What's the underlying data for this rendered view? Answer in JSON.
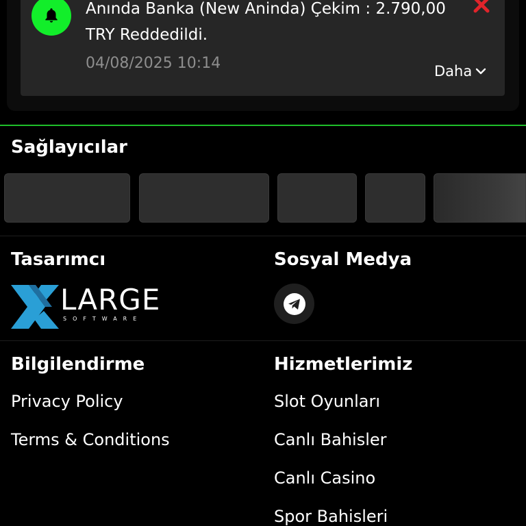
{
  "notification": {
    "message": "Anında Banka (New Aninda) Çekim : 2.790,00 TRY Reddedildi.",
    "timestamp": "04/08/2025 10:14",
    "more_label": "Daha",
    "icon": "bell-icon",
    "close_icon": "close-icon",
    "bell_color": "#12ee2a",
    "close_color": "#e0242b"
  },
  "providers": {
    "title": "Sağlayıcılar"
  },
  "designer": {
    "title": "Tasarımcı",
    "logo_main": "LARGE",
    "logo_sub": "SOFTWARE"
  },
  "social": {
    "title": "Sosyal Medya",
    "icon": "telegram-icon"
  },
  "info": {
    "title": "Bilgilendirme",
    "links": [
      "Privacy Policy",
      "Terms & Conditions"
    ]
  },
  "services": {
    "title": "Hizmetlerimiz",
    "links": [
      "Slot Oyunları",
      "Canlı Bahisler",
      "Canlı Casino",
      "Spor Bahisleri"
    ]
  },
  "accent_color": "#1fbf2a"
}
